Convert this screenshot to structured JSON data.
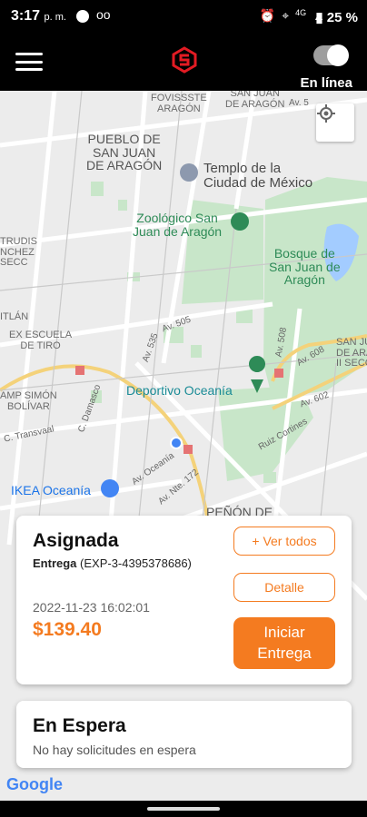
{
  "status_bar": {
    "time": "3:17",
    "ampm": "p. m.",
    "voicemail": "oo",
    "network": "4G",
    "battery": "25 %"
  },
  "app_bar": {
    "online_label": "En línea",
    "online": true,
    "brand_color": "#e31b23"
  },
  "map": {
    "labels": {
      "fovissste": "FOVISSSTE\nARAGÓN",
      "san_juan_top": "SAN JUAN\nDE ARAGÓN",
      "pueblo": "PUEBLO DE\nSAN JUAN\nDE ARAGÓN",
      "templo": "Templo de la\nCiudad de México",
      "zoologico": "Zoológico San\nJuan de Aragón",
      "bosque": "Bosque de\nSan Juan de\nAragón",
      "trudis": "TRUDIS\nNCHEZ\nSECC",
      "itlan": "ITLÁN",
      "escuela": "EX ESCUELA\nDE TIRO",
      "san_juan_right": "SAN JUAN\nDE ARAG\nII SECC",
      "campo": "AMP SIMÓN\nBOLÍVAR",
      "deportivo": "Deportivo Oceanía",
      "ikea": "IKEA Oceanía",
      "penon": "PEÑÓN DE",
      "av_505": "Av. 505",
      "av_535": "Av. 535",
      "av_508": "Av. 508",
      "av_602": "Av. 602",
      "av_608": "Av. 608",
      "av_oceania": "Av. Oceanía",
      "c_transvaal": "C. Transvaal",
      "c_damasco": "C. Damasco",
      "ruiz": "Ruiz Cortines",
      "norte_172": "Av. Nte. 172",
      "av_top": "Av. 5"
    },
    "google": "Google"
  },
  "assigned_card": {
    "title": "Asignada",
    "type_label": "Entrega",
    "code": "(EXP-3-4395378686)",
    "date": "2022-11-23 16:02:01",
    "price": "$139.40",
    "see_all_label": "+ Ver todos",
    "detail_label": "Detalle",
    "start_label": "Iniciar\nEntrega"
  },
  "waiting_card": {
    "title": "En Espera",
    "message": "No hay solicitudes en espera"
  },
  "colors": {
    "accent": "#f47b20",
    "park": "#c8e6c9",
    "water": "#a3ccff"
  }
}
